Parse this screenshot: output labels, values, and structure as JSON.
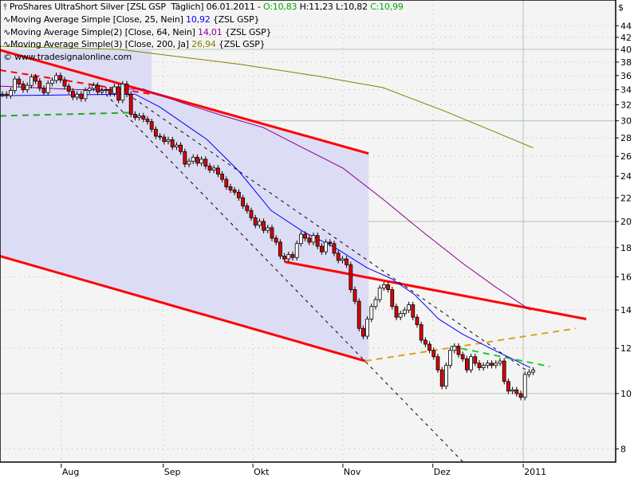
{
  "chart_data": {
    "type": "candlestick",
    "title": "ProShares UltraShort Silver [ZSL GSP  Täglich] 06.01.2011",
    "header": {
      "dash": "-",
      "o_label": "O:",
      "o": "10,83",
      "h_label": "H:",
      "h": "11,23",
      "l_label": "L:",
      "l": "10,82",
      "c_label": "C:",
      "c": "10,99"
    },
    "indicators": [
      {
        "label": "Moving Average Simple [Close, 25, Nein]",
        "value": "10,92",
        "suffix": "{ZSL GSP}",
        "color": "#0000ff"
      },
      {
        "label": "Moving Average Simple(2) [Close, 64, Nein]",
        "value": "14,01",
        "suffix": "{ZSL GSP}",
        "color": "#8b008b"
      },
      {
        "label": "Moving Average Simple(3) [Close, 200, Ja]",
        "value": "26,94",
        "suffix": "{ZSL GSP}",
        "color": "#808000"
      }
    ],
    "copyright": "© www.tradesignalonline.com",
    "y_axis": {
      "unit": "$",
      "scale": "log",
      "ylim": [
        7.6,
        46
      ],
      "ticks": [
        44,
        42,
        40,
        38,
        36,
        34,
        32,
        30,
        28,
        26,
        24,
        22,
        20,
        18,
        16,
        14,
        12,
        10,
        8
      ],
      "major": [
        10,
        20,
        30,
        40
      ]
    },
    "x_axis": {
      "ticks": [
        {
          "label": "Aug",
          "index": 14.2
        },
        {
          "label": "Sep",
          "index": 38.8
        },
        {
          "label": "Okt",
          "index": 60.4
        },
        {
          "label": "Nov",
          "index": 82.1
        },
        {
          "label": "Dez",
          "index": 103.8
        },
        {
          "label": "2011",
          "index": 125.6
        }
      ]
    },
    "close": [
      33.4,
      33.2,
      33.9,
      35.5,
      34.8,
      34.0,
      34.6,
      35.8,
      35.2,
      34.2,
      33.6,
      34.9,
      35.3,
      36.0,
      35.4,
      34.5,
      33.8,
      33.0,
      33.4,
      32.8,
      33.9,
      34.2,
      34.6,
      33.7,
      33.9,
      34.0,
      33.5,
      34.4,
      32.6,
      34.8,
      33.4,
      30.8,
      30.4,
      30.6,
      30.2,
      29.9,
      29.0,
      28.2,
      28.1,
      27.6,
      27.8,
      27.0,
      27.2,
      26.5,
      25.2,
      25.5,
      25.9,
      25.3,
      25.7,
      25.0,
      24.6,
      24.8,
      24.2,
      23.7,
      23.0,
      22.7,
      22.5,
      22.0,
      21.3,
      20.9,
      20.3,
      19.7,
      20.0,
      19.3,
      19.5,
      18.7,
      18.4,
      17.4,
      17.2,
      17.5,
      17.3,
      18.3,
      19.0,
      18.7,
      18.4,
      18.9,
      18.1,
      17.7,
      18.4,
      18.3,
      17.6,
      17.1,
      17.2,
      16.8,
      15.2,
      14.5,
      13.0,
      12.6,
      13.5,
      14.2,
      14.6,
      15.3,
      15.5,
      15.2,
      14.2,
      13.6,
      13.8,
      14.0,
      14.3,
      13.6,
      13.2,
      12.4,
      12.2,
      11.9,
      11.6,
      11.0,
      10.3,
      11.2,
      11.9,
      12.1,
      11.7,
      11.5,
      11.0,
      11.6,
      11.3,
      11.1,
      11.2,
      11.3,
      11.2,
      11.3,
      11.4,
      10.5,
      10.1,
      10.15,
      10.0,
      9.85,
      10.8,
      10.9,
      10.99
    ],
    "moving_averages": [
      {
        "name": "MA25",
        "color": "#0000ff",
        "points": [
          [
            -0.6,
            33.2
          ],
          [
            32,
            33.4
          ],
          [
            38,
            31.7
          ],
          [
            49.4,
            27.8
          ],
          [
            57,
            24.5
          ],
          [
            64.8,
            20.9
          ],
          [
            72.5,
            19.2
          ],
          [
            80.2,
            18.0
          ],
          [
            87.9,
            16.6
          ],
          [
            93.7,
            15.9
          ],
          [
            99.4,
            14.9
          ],
          [
            105.2,
            13.5
          ],
          [
            111,
            12.7
          ],
          [
            118.7,
            11.9
          ],
          [
            127.3,
            11.1
          ]
        ]
      },
      {
        "name": "MA64",
        "color": "#8b008b",
        "points": [
          [
            -0.6,
            34.5
          ],
          [
            18.7,
            34.0
          ],
          [
            34,
            34.1
          ],
          [
            43.7,
            32.2
          ],
          [
            53.3,
            30.6
          ],
          [
            62.9,
            29.2
          ],
          [
            72.5,
            26.9
          ],
          [
            82.1,
            24.8
          ],
          [
            91.7,
            21.9
          ],
          [
            101.3,
            19.2
          ],
          [
            111,
            16.9
          ],
          [
            118.7,
            15.4
          ],
          [
            127.3,
            14.0
          ]
        ]
      },
      {
        "name": "MA200",
        "color": "#808000",
        "points": [
          [
            -0.6,
            40.5
          ],
          [
            28.3,
            40.0
          ],
          [
            57,
            37.7
          ],
          [
            76.3,
            35.9
          ],
          [
            91.7,
            34.3
          ],
          [
            107.1,
            31.1
          ],
          [
            118.7,
            28.7
          ],
          [
            128,
            26.9
          ]
        ]
      }
    ],
    "drawings": [
      {
        "name": "upper-channel-line",
        "color": "#ff0000",
        "style": "solid",
        "from": [
          -0.6,
          39.9
        ],
        "to": [
          88.3,
          26.3
        ]
      },
      {
        "name": "lower-channel-line",
        "color": "#ff0000",
        "style": "solid",
        "from": [
          -0.6,
          17.4
        ],
        "to": [
          87.5,
          11.4
        ]
      },
      {
        "name": "resistance-line",
        "color": "#ff0000",
        "style": "solid",
        "from": [
          68.1,
          17.0
        ],
        "to": [
          140.8,
          13.5
        ]
      },
      {
        "name": "dashed-trend-1",
        "color": "#000000",
        "style": "dashed",
        "from": [
          22.5,
          34.8
        ],
        "to": [
          111,
          7.6
        ]
      },
      {
        "name": "dashed-trend-2",
        "color": "#000000",
        "style": "dashed",
        "from": [
          30.2,
          33.4
        ],
        "to": [
          127,
          10.9
        ]
      },
      {
        "name": "red-dashed-line",
        "color": "#ff0000",
        "style": "dashed",
        "from": [
          -0.6,
          36.8
        ],
        "to": [
          36,
          33.4
        ]
      },
      {
        "name": "green-dashed-line-1",
        "color": "#22aa22",
        "style": "dashed",
        "from": [
          -0.6,
          30.6
        ],
        "to": [
          31,
          31.0
        ]
      },
      {
        "name": "green-dashed-line-2",
        "color": "#22cc22",
        "style": "dashed",
        "from": [
          108,
          12.1
        ],
        "to": [
          132,
          11.15
        ]
      },
      {
        "name": "orange-dashed-line",
        "color": "#e0a020",
        "style": "dashed",
        "from": [
          87.5,
          11.4
        ],
        "to": [
          138.3,
          13.0
        ]
      }
    ],
    "shaded_channel": {
      "color": "#dcdcf4",
      "from_index": -0.6,
      "to_index": 88.3
    }
  }
}
